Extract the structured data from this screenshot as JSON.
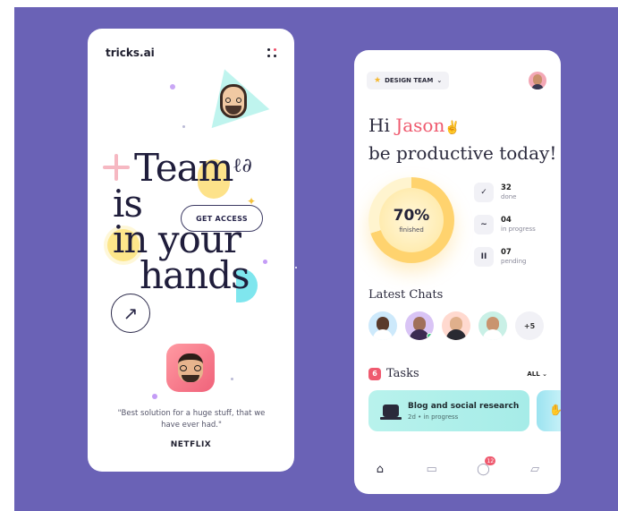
{
  "left_phone": {
    "logo": "tricks.ai",
    "hero": {
      "line1": "Team",
      "line2": "is",
      "line3": "in your",
      "line4": "hands"
    },
    "cta_label": "GET ACCESS",
    "arrow_glyph": "↗",
    "quote": "\"Best solution for a huge stuff, that we have ever had.\"",
    "brand": "NETFLIX",
    "swirl_glyph": "ℓ∂",
    "star_glyph": "✦"
  },
  "right_phone": {
    "team_selector": {
      "label": "DESIGN TEAM",
      "chevron": "⌄",
      "icon": "star-icon",
      "icon_glyph": "★"
    },
    "greeting": {
      "hi": "Hi ",
      "name": "Jason",
      "hand": "✌",
      "line2": "be productive today!"
    },
    "progress": {
      "value": 70,
      "label": "70%",
      "sub": "finished"
    },
    "stats": [
      {
        "icon": "check-icon",
        "glyph": "✓",
        "count": "32",
        "label": "done"
      },
      {
        "icon": "trend-icon",
        "glyph": "∼",
        "count": "04",
        "label": "in progress"
      },
      {
        "icon": "pause-icon",
        "glyph": "II",
        "count": "07",
        "label": "pending"
      }
    ],
    "latest_chats_title": "Latest Chats",
    "chat_more": "+5",
    "tasks": {
      "count": "6",
      "title": "Tasks",
      "filter": "ALL ⌄",
      "cards": [
        {
          "title": "Blog and social research",
          "meta": "2d • in progress"
        }
      ],
      "peek_glyph": "✋"
    },
    "nav": {
      "home": "⌂",
      "calendar": "▭",
      "chat": "◯",
      "chat_badge": "12",
      "folder": "▱"
    }
  },
  "colors": {
    "background": "#6a62b6",
    "accent_red": "#ef5a6f",
    "progress_yellow": "#ffd36e",
    "task_teal": "#b8f2ec"
  }
}
